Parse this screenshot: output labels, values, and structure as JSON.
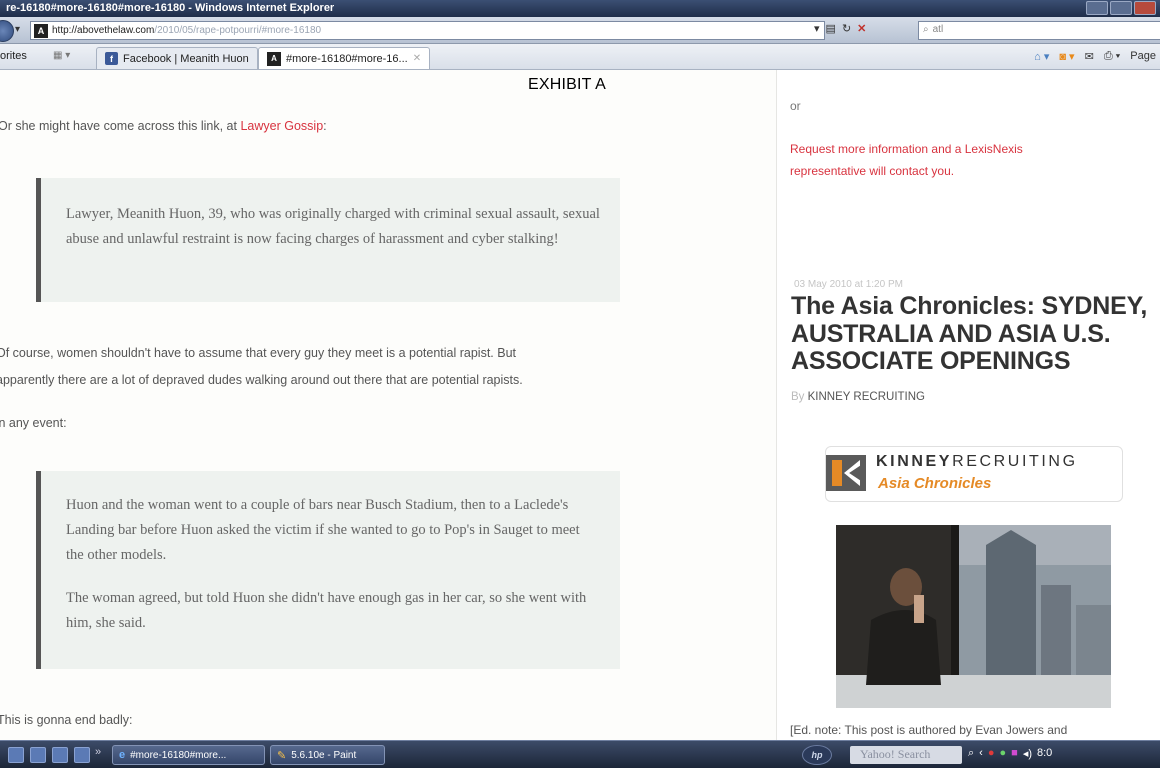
{
  "window": {
    "title": "re-16180#more-16180#more-16180 - Windows Internet Explorer"
  },
  "address_bar": {
    "url_host": "http://abovethelaw.com",
    "url_path": "/2010/05/rape-potpourri/#more-16180",
    "site_icon": "A",
    "search_value": "atl"
  },
  "favorites": {
    "label": "orites",
    "tabs": [
      {
        "label": "Facebook | Meanith Huon",
        "icon": "facebook-icon"
      },
      {
        "label": "#more-16180#more-16...",
        "icon": "atl-icon",
        "active": true
      }
    ],
    "command_page": "Page"
  },
  "exhibit_label": "EXHIBIT A",
  "article": {
    "lead_prefix": "Or she might have come across this link, at ",
    "lead_link": "Lawyer Gossip",
    "lead_suffix": ":",
    "quote1": "Lawyer, Meanith Huon, 39, who was originally charged with criminal sexual assault, sexual abuse and unlawful restraint is now facing charges of harassment and cyber stalking!",
    "para_line1": "Of course, women shouldn't have to assume that every guy they meet is a potential rapist. But",
    "para_line2": "apparently there are a lot of depraved dudes walking around out there that are potential rapists.",
    "any_event": "In any event:",
    "quote2_p1": "Huon and the woman went to a couple of bars near Busch Stadium, then to a Laclede's Landing bar before Huon asked the victim if she wanted to go to Pop's in Sauget to meet the other models.",
    "quote2_p2": "The woman agreed, but told Huon she didn't have enough gas in her car, so she went with him, she said.",
    "closing": "This is gonna end badly:"
  },
  "sidebar": {
    "or_text": "or",
    "request_text": "Request more information and a LexisNexis representative will contact you.",
    "date": "03 May 2010 at 1:20 PM",
    "title": "The Asia Chronicles: SYDNEY, AUSTRALIA AND ASIA U.S. ASSOCIATE OPENINGS",
    "by_prefix": "By",
    "author": "KINNEY RECRUITING",
    "logo_bold": "KINNEY",
    "logo_light": "RECRUITING",
    "logo_sub": "Asia Chronicles",
    "note": "[Ed. note: This post is authored by Evan Jowers and"
  },
  "taskbar": {
    "item1": "#more-16180#more...",
    "item2": "5.6.10e - Paint",
    "hp_label": "hp",
    "yahoo_search": "Yahoo! Search",
    "clock": "8:0"
  }
}
